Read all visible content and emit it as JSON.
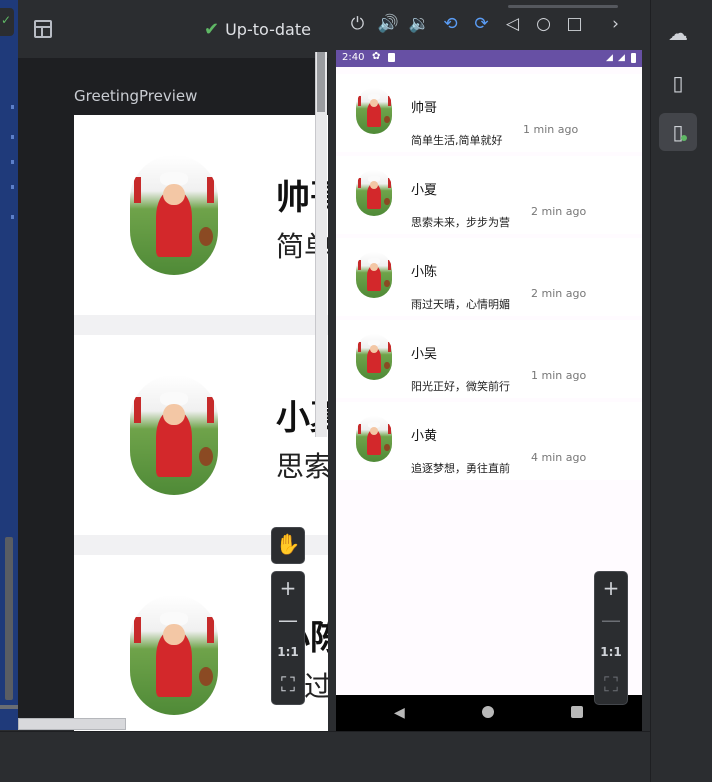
{
  "preview": {
    "status_label": "Up-to-date",
    "title": "GreetingPreview",
    "rows": [
      {
        "name": "帅哥",
        "message": "简单生活,简单就好"
      },
      {
        "name": "小夏",
        "message": "思索未来，步步为营"
      },
      {
        "name": "小陈",
        "message": "雨过天晴，心情明媚"
      }
    ],
    "zoom": {
      "pan": "✋",
      "zoom_in": "+",
      "zoom_out": "—",
      "one_to_one": "1:1",
      "fit": "⛶"
    }
  },
  "device_toolbar": {
    "icons": [
      "power-icon",
      "volume-up-icon",
      "volume-down-icon",
      "rotate-left-icon",
      "rotate-right-icon",
      "back-icon",
      "home-icon",
      "overview-icon",
      "more-icon"
    ]
  },
  "emulator": {
    "status_bar": {
      "time": "2:40"
    },
    "contacts": [
      {
        "name": "帅哥",
        "message": "简单生活,简单就好",
        "time": "1 min ago"
      },
      {
        "name": "小夏",
        "message": "思索未来，步步为营",
        "time": "2 min ago"
      },
      {
        "name": "小陈",
        "message": "雨过天晴，心情明媚",
        "time": "2 min ago"
      },
      {
        "name": "小吴",
        "message": "阳光正好，微笑前行",
        "time": "1 min ago"
      },
      {
        "name": "小黄",
        "message": "追逐梦想，勇往直前",
        "time": "4 min ago"
      }
    ],
    "zoom": {
      "zoom_in": "+",
      "zoom_out": "—",
      "one_to_one": "1:1",
      "fit": "⛶"
    }
  },
  "colors": {
    "status_bar": "#6750a4",
    "check": "#5fb865",
    "highlight": "#5a9cf5"
  }
}
